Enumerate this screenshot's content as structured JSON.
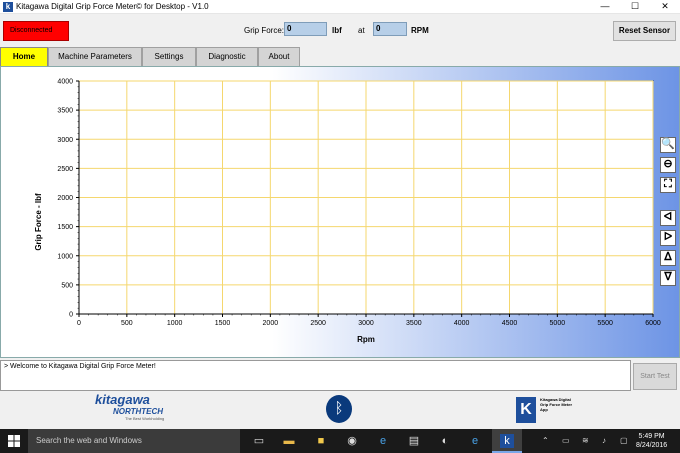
{
  "window": {
    "app_icon_letter": "k",
    "title": "Kitagawa Digital Grip Force Meter© for Desktop - V1.0",
    "minimize": "—",
    "maximize": "☐",
    "close": "✕"
  },
  "toolbar": {
    "status": "Disconnected",
    "status_color": "#ff0000",
    "grip_force_label": "Grip Force:",
    "grip_force_value": "0",
    "grip_force_unit": "lbf",
    "at_label": "at",
    "rpm_value": "0",
    "rpm_unit": "RPM",
    "reset_label": "Reset Sensor"
  },
  "tabs": [
    {
      "label": "Home",
      "active": true
    },
    {
      "label": "Machine Parameters",
      "active": false
    },
    {
      "label": "Settings",
      "active": false
    },
    {
      "label": "Diagnostic",
      "active": false
    },
    {
      "label": "About",
      "active": false
    }
  ],
  "chart_data": {
    "type": "line",
    "series": [],
    "xlabel": "Rpm",
    "ylabel": "Grip Force - lbf",
    "xlim": [
      0,
      6000
    ],
    "ylim": [
      0,
      4000
    ],
    "x_ticks": [
      0,
      500,
      1000,
      1500,
      2000,
      2500,
      3000,
      3500,
      4000,
      4500,
      5000,
      5500,
      6000
    ],
    "y_ticks": [
      0,
      500,
      1000,
      1500,
      2000,
      2500,
      3000,
      3500,
      4000
    ],
    "grid": true,
    "grid_color": "#f5d76e"
  },
  "chart_tools": [
    {
      "name": "zoom-in-icon",
      "glyph": "🔍"
    },
    {
      "name": "zoom-out-icon",
      "glyph": "⊖"
    },
    {
      "name": "fit-view-icon",
      "glyph": "⛶"
    },
    {
      "name": "pan-left-icon",
      "glyph": "ᐊ"
    },
    {
      "name": "pan-right-icon",
      "glyph": "ᐅ"
    },
    {
      "name": "pan-up-icon",
      "glyph": "ᐃ"
    },
    {
      "name": "pan-down-icon",
      "glyph": "ᐁ"
    }
  ],
  "console": {
    "text": "> Welcome to Kitagawa Digital Grip Force Meter!",
    "start_label": "Start Test"
  },
  "footer": {
    "kitagawa_logo": "kitagawa",
    "northtech_logo": "NORTHTECH",
    "northtech_tagline": "The Best Workholding",
    "bluetooth_glyph": "ᛒ",
    "app_logo_letter": "K",
    "app_logo_text": "Kitagawa Digital Grip Force Meter App"
  },
  "taskbar": {
    "search_placeholder": "Search the web and Windows",
    "time": "5:49 PM",
    "date": "8/24/2016",
    "accent": "#7aa7e8"
  }
}
